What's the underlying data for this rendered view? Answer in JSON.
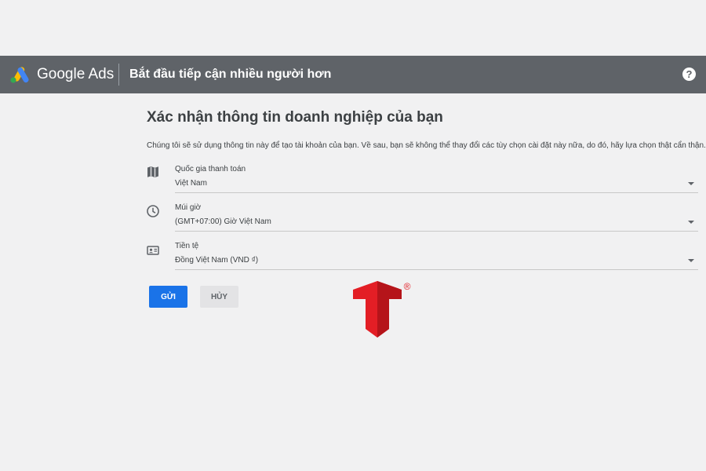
{
  "header": {
    "brand": "Google Ads",
    "title": "Bắt đầu tiếp cận nhiều người hơn",
    "help_symbol": "?",
    "logo_icon": "google-ads-logo",
    "help_icon": "help-circle-icon",
    "background_color": "#5f6368"
  },
  "main": {
    "title": "Xác nhận thông tin doanh nghiệp của bạn",
    "description": "Chúng tôi sẽ sử dụng thông tin này để tạo tài khoản của bạn. Về sau, bạn sẽ không thể thay đổi các tùy chọn cài đặt này nữa, do đó, hãy lựa chọn thật cẩn thận.",
    "fields": [
      {
        "label": "Quốc gia thanh toán",
        "value": "Việt Nam",
        "icon": "map-icon"
      },
      {
        "label": "Múi giờ",
        "value": "(GMT+07:00) Giờ Việt Nam",
        "icon": "clock-icon"
      },
      {
        "label": "Tiền tệ",
        "value": "Đồng Việt Nam (VND ₫)",
        "icon": "currency-card-icon"
      }
    ],
    "submit_label": "GỬI",
    "cancel_label": "HỦY"
  },
  "colors": {
    "primary": "#1a73e8",
    "watermark_red": "#e31e25"
  },
  "watermark": {
    "icon": "t-logo-watermark",
    "registered_mark": "®"
  }
}
